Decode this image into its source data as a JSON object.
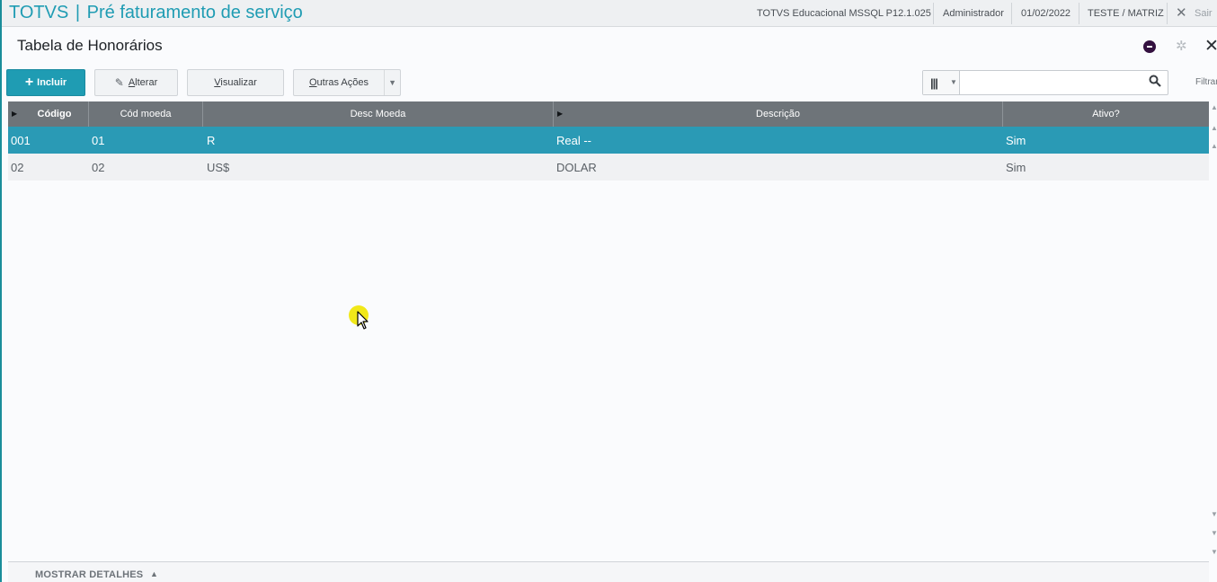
{
  "header": {
    "brand": "TOTVS",
    "separator": "|",
    "module": "Pré faturamento de serviço",
    "environment": "TOTVS Educacional MSSQL P12.1.025",
    "user": "Administrador",
    "date": "01/02/2022",
    "company": "TESTE / MATRIZ",
    "exit_label": "Sair"
  },
  "page": {
    "title": "Tabela de Honorários"
  },
  "toolbar": {
    "include_label": "Incluir",
    "edit_label_accel": "A",
    "edit_label_rest": "lterar",
    "view_label_accel": "V",
    "view_label_rest": "isualizar",
    "more_label_accel": "O",
    "more_label_rest": "utras Ações",
    "search_placeholder": "",
    "filter_label": "Filtrar"
  },
  "grid": {
    "columns": [
      "Código",
      "Cód moeda",
      "Desc Moeda",
      "Descrição",
      "Ativo?"
    ],
    "rows": [
      {
        "codigo": "001",
        "cod_moeda": "01",
        "desc_moeda": "R",
        "descricao": "Real --",
        "ativo": "Sim",
        "selected": true
      },
      {
        "codigo": "02",
        "cod_moeda": "02",
        "desc_moeda": "US$",
        "descricao": "DOLAR",
        "ativo": "Sim",
        "selected": false
      }
    ]
  },
  "footer": {
    "details_label": "MOSTRAR DETALHES"
  },
  "icons": {
    "close": "close-icon",
    "settings": "gear-icon",
    "help": "dot-icon",
    "search": "search-icon",
    "columns": "columns-icon"
  },
  "colors": {
    "accent": "#1f9cb3",
    "header_bg": "#6e7479",
    "selected_row": "#2a9ab5"
  }
}
